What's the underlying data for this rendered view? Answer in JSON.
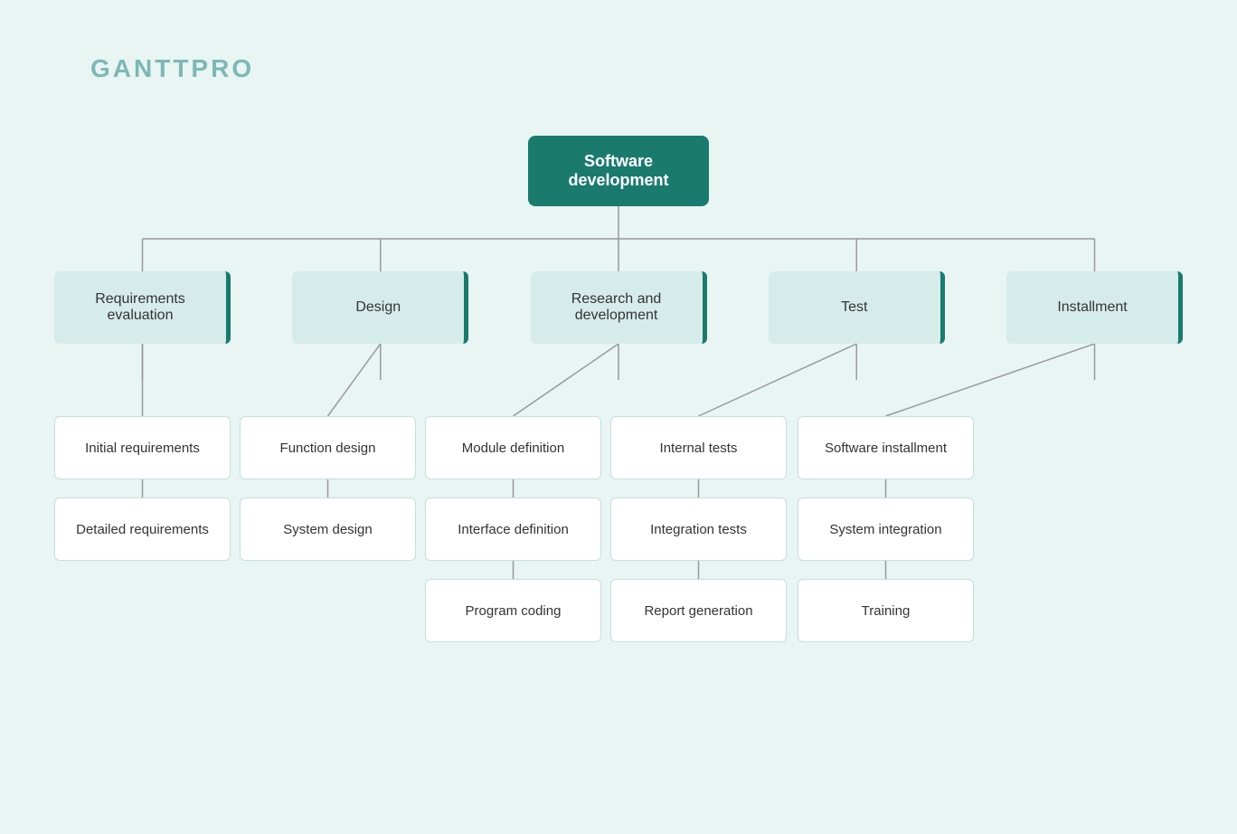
{
  "logo": {
    "text": "GANTTPRO"
  },
  "root": {
    "label": "Software development"
  },
  "level1": [
    {
      "id": "req",
      "label": "Requirements evaluation"
    },
    {
      "id": "design",
      "label": "Design"
    },
    {
      "id": "research",
      "label": "Research and development"
    },
    {
      "id": "test",
      "label": "Test"
    },
    {
      "id": "install",
      "label": "Installment"
    }
  ],
  "level2": {
    "req": [
      "Initial requirements",
      "Detailed requirements"
    ],
    "design": [
      "Function design",
      "System design"
    ],
    "research": [
      "Module definition",
      "Interface definition",
      "Program coding"
    ],
    "test": [
      "Internal tests",
      "Integration tests",
      "Report generation"
    ],
    "install": [
      "Software installment",
      "System integration",
      "Training"
    ]
  }
}
